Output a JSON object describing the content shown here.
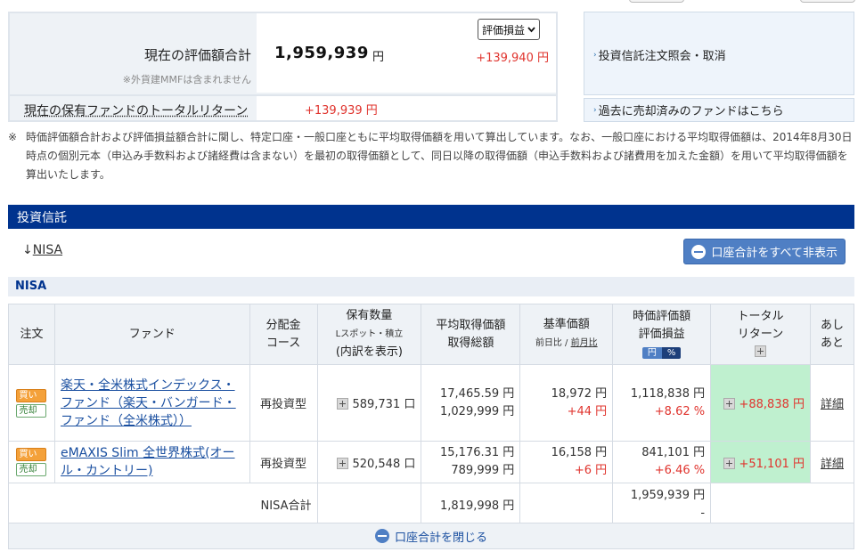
{
  "summary": {
    "eval_total_label": "現在の評価額合計",
    "mmf_note": "※外貨建MMFは含まれません",
    "eval_total_value": "1,959,939",
    "eval_unit": "円",
    "select_value": "評価損益",
    "profit_loss": "+139,940 円",
    "total_return_label": "現在の保有ファンドのトータルリターン",
    "total_return_value": "+139,939 円"
  },
  "links": {
    "order_inquiry": "投資信託注文照会・取消",
    "sold_funds": "過去に売却済みのファンドはこちら"
  },
  "note": {
    "mark": "※",
    "text": "時価評価額合計および評価損益額合計に関し、特定口座・一般口座ともに平均取得価額を用いて算出しています。なお、一般口座における平均取得価額は、2014年8月30日時点の個別元本（申込み手数料および諸経費は含まない）を最初の取得価額として、同日以降の取得価額（申込手数料および諸費用を加えた金額）を用いて平均取得価額を算出いたします。"
  },
  "section": {
    "title": "投資信託",
    "nisa_anchor_arrow": "↓",
    "nisa_anchor": "NISA",
    "hide_all_button": "口座合計をすべて非表示",
    "nisa_label": "NISA"
  },
  "table": {
    "headers": {
      "order": "注文",
      "fund": "ファンド",
      "dist_1": "分配金",
      "dist_2": "コース",
      "qty_1": "保有数量",
      "qty_sub": "Lスポット・積立",
      "qty_2": "(内訳を表示)",
      "avg_1": "平均取得価額",
      "avg_2": "取得総額",
      "base_1": "基準価額",
      "base_sub_a": "前日比",
      "base_sub_sep": " / ",
      "base_sub_b": "前月比",
      "mv_1": "時価評価額",
      "mv_2": "評価損益",
      "toggle_yen": "円",
      "toggle_pct": "%",
      "tr_1": "トータル",
      "tr_2": "リターン",
      "ashi_1": "あし",
      "ashi_2": "あと"
    },
    "buy_label": "買い",
    "sell_label": "売却",
    "rows": [
      {
        "fund": "楽天・全米株式インデックス・ファンド（楽天・バンガード・ファンド（全米株式））",
        "course": "再投資型",
        "qty": "589,731 口",
        "avg_price": "17,465.59 円",
        "total_cost": "1,029,999 円",
        "base_price": "18,972 円",
        "base_change": "+44 円",
        "market_value": "1,118,838 円",
        "pl": "+8.62 %",
        "total_return": "+88,838 円",
        "detail": "詳細"
      },
      {
        "fund": "eMAXIS Slim 全世界株式(オール・カントリー)",
        "course": "再投資型",
        "qty": "520,548 口",
        "avg_price": "15,176.31 円",
        "total_cost": "789,999 円",
        "base_price": "16,158 円",
        "base_change": "+6 円",
        "market_value": "841,101 円",
        "pl": "+6.46 %",
        "total_return": "+51,101 円",
        "detail": "詳細"
      }
    ],
    "total_row": {
      "label": "NISA合計",
      "total_cost": "1,819,998 円",
      "market_value": "1,959,939 円",
      "pl": "-"
    }
  },
  "close_button": "口座合計を閉じる",
  "colors": {
    "header_blue": "#00338e",
    "positive_red": "#e0342e",
    "return_green": "#bff0cf",
    "button_blue": "#4f7fc4"
  }
}
